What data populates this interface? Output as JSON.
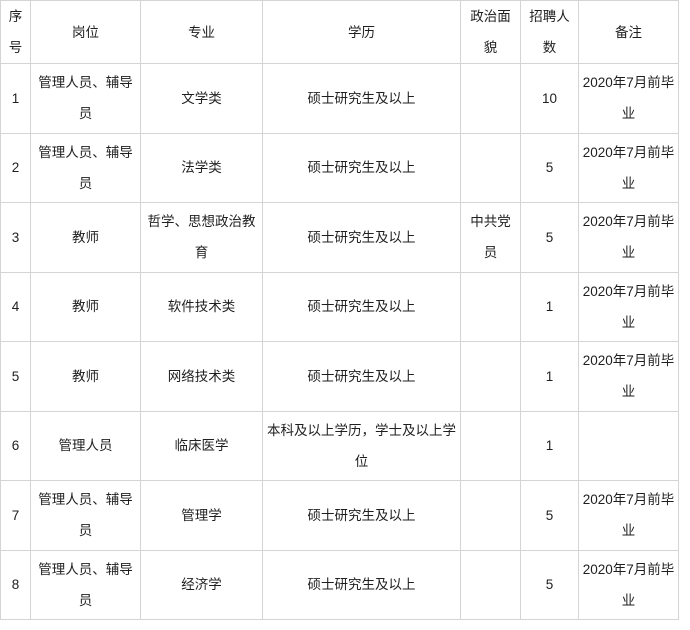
{
  "table": {
    "columns": [
      {
        "key": "seq",
        "label": "序\n号",
        "name": "column-sequence"
      },
      {
        "key": "post",
        "label": "岗位",
        "name": "column-position"
      },
      {
        "key": "major",
        "label": "专业",
        "name": "column-major"
      },
      {
        "key": "edu",
        "label": "学历",
        "name": "column-education"
      },
      {
        "key": "party",
        "label": "政治面貌",
        "name": "column-political-status"
      },
      {
        "key": "count",
        "label": "招聘人数",
        "name": "column-headcount"
      },
      {
        "key": "remark",
        "label": "备注",
        "name": "column-remark"
      }
    ],
    "headers": {
      "seq": "序号",
      "post": "岗位",
      "major": "专业",
      "edu": "学历",
      "party": "政治面貌",
      "count": "招聘人数",
      "remark": "备注"
    },
    "rows": [
      {
        "seq": "1",
        "post": "管理人员、辅导员",
        "major": "文学类",
        "edu": "硕士研究生及以上",
        "party": "",
        "count": "10",
        "remark": "2020年7月前毕业"
      },
      {
        "seq": "2",
        "post": "管理人员、辅导员",
        "major": "法学类",
        "edu": "硕士研究生及以上",
        "party": "",
        "count": "5",
        "remark": "2020年7月前毕业"
      },
      {
        "seq": "3",
        "post": "教师",
        "major": "哲学、思想政治教育",
        "edu": "硕士研究生及以上",
        "party": "中共党员",
        "count": "5",
        "remark": "2020年7月前毕业"
      },
      {
        "seq": "4",
        "post": "教师",
        "major": "软件技术类",
        "edu": "硕士研究生及以上",
        "party": "",
        "count": "1",
        "remark": "2020年7月前毕业"
      },
      {
        "seq": "5",
        "post": "教师",
        "major": "网络技术类",
        "edu": "硕士研究生及以上",
        "party": "",
        "count": "1",
        "remark": "2020年7月前毕业"
      },
      {
        "seq": "6",
        "post": "管理人员",
        "major": "临床医学",
        "edu": "本科及以上学历，学士及以上学位",
        "party": "",
        "count": "1",
        "remark": ""
      },
      {
        "seq": "7",
        "post": "管理人员、辅导员",
        "major": "管理学",
        "edu": "硕士研究生及以上",
        "party": "",
        "count": "5",
        "remark": "2020年7月前毕业"
      },
      {
        "seq": "8",
        "post": "管理人员、辅导员",
        "major": "经济学",
        "edu": "硕士研究生及以上",
        "party": "",
        "count": "5",
        "remark": "2020年7月前毕业"
      }
    ]
  },
  "style": {
    "border_color": "#d4d4d4",
    "text_color": "#1f1f1f",
    "background": "#ffffff"
  }
}
